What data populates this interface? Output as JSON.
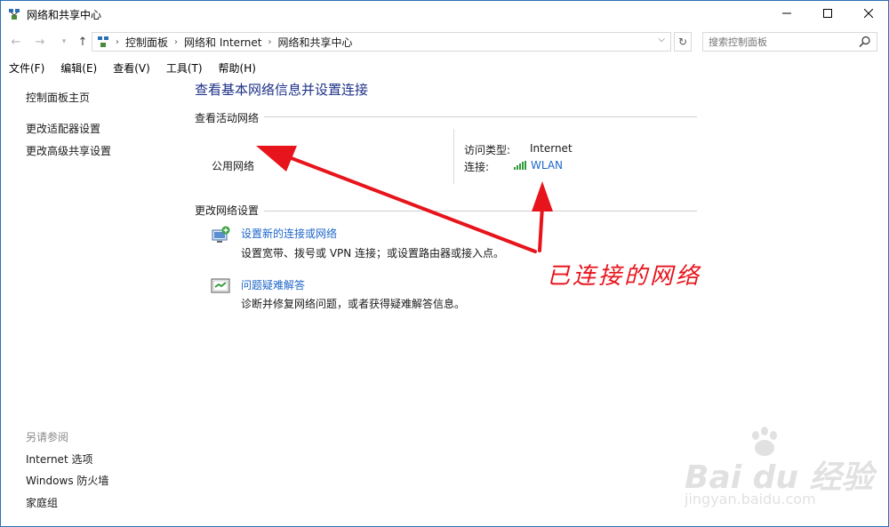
{
  "window": {
    "title": "网络和共享中心",
    "controls": {
      "minimize": "—",
      "maximize": "☐",
      "close": "✕"
    }
  },
  "address": {
    "breadcrumbs": [
      "控制面板",
      "网络和 Internet",
      "网络和共享中心"
    ],
    "search_placeholder": "搜索控制面板"
  },
  "menu": [
    "文件(F)",
    "编辑(E)",
    "查看(V)",
    "工具(T)",
    "帮助(H)"
  ],
  "sidebar": {
    "links": [
      "控制面板主页",
      "更改适配器设置",
      "更改高级共享设置"
    ],
    "see_also_title": "另请参阅",
    "see_also": [
      "Internet 选项",
      "Windows 防火墙",
      "家庭组"
    ]
  },
  "main": {
    "title": "查看基本网络信息并设置连接",
    "active_networks": {
      "heading": "查看活动网络",
      "network_name": "公用网络",
      "access_type_label": "访问类型:",
      "access_type_value": "Internet",
      "connection_label": "连接:",
      "connection_value": "WLAN"
    },
    "change_settings": {
      "heading": "更改网络设置",
      "tasks": [
        {
          "link": "设置新的连接或网络",
          "desc": "设置宽带、拨号或 VPN 连接；或设置路由器或接入点。",
          "icon": "new-connection-icon"
        },
        {
          "link": "问题疑难解答",
          "desc": "诊断并修复网络问题，或者获得疑难解答信息。",
          "icon": "troubleshoot-icon"
        }
      ]
    }
  },
  "annotation": {
    "text": "已连接的网络",
    "color": "#e8141c"
  },
  "watermark": {
    "brand": "Bai du 经验",
    "url": "jingyan.baidu.com"
  },
  "colors": {
    "link": "#1e66c9",
    "title": "#1e3287",
    "window_border": "#2b6fb6"
  }
}
